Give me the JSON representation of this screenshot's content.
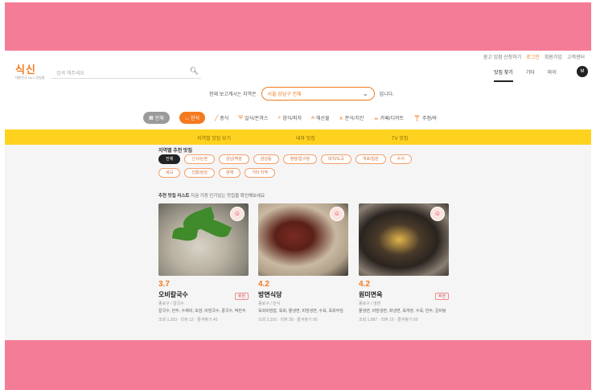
{
  "header": {
    "util_links": [
      "광고 입점 신청하기",
      "로그인",
      "회원가입",
      "고객센터"
    ],
    "logo_text": "식신",
    "logo_sub": "대한민국 No.1 맛집앱",
    "search_placeholder": "검색 해주세요",
    "nav": [
      "맛집 찾기",
      "기타",
      "마이"
    ],
    "avatar_label": "M"
  },
  "location": {
    "label": "현재 보고계시는 지역은",
    "selected": "서울 강남구 전체",
    "suffix": "입니다."
  },
  "categories": [
    {
      "label": "전체",
      "style": "gray",
      "icon": "grid-icon"
    },
    {
      "label": "한식",
      "style": "orange",
      "icon": "bowl-icon"
    },
    {
      "label": "중식",
      "style": "plain",
      "icon": "chopstick-icon"
    },
    {
      "label": "일식/돈까스",
      "style": "plain",
      "icon": "fork-icon"
    },
    {
      "label": "양식/피자",
      "style": "plain",
      "icon": "search-icon"
    },
    {
      "label": "해산물",
      "style": "plain",
      "icon": "fish-icon"
    },
    {
      "label": "분식/치킨",
      "style": "plain",
      "icon": "mountain-icon"
    },
    {
      "label": "카페/디저트",
      "style": "plain",
      "icon": "cup-icon"
    },
    {
      "label": "주점/바",
      "style": "plain",
      "icon": "glass-icon"
    }
  ],
  "tabs": [
    "지역별 맛집 보기",
    "테마 맛집",
    "TV 맛집"
  ],
  "region": {
    "title": "지역별 추천 맛집",
    "chips": [
      "전체",
      "신사/논현",
      "강남/역삼",
      "삼성동",
      "청담/압구정",
      "대치/도곡",
      "개포/일원",
      "수서",
      "세곡",
      "선릉/삼성",
      "양재",
      "기타 지역"
    ],
    "selected_index": 0
  },
  "recommend": {
    "title": "추천 맛집 리스트",
    "subtitle": "지금 가장 인기있는 맛집을 확인해보세요"
  },
  "restaurants": [
    {
      "rating": "3.7",
      "name": "오비칼국수",
      "tag": "추천",
      "location": "종로구 / 칼국수",
      "menu": "칼국수, 만두, 수제비, 보쌈, 비빔국수, 콩국수, 떡만두",
      "stats": "조회 1,203 · 리뷰 12 · 즐겨찾기 45"
    },
    {
      "rating": "4.2",
      "name": "방면식당",
      "tag": "",
      "location": "종로구 / 한식",
      "menu": "육회비빔밥, 육회, 물냉면, 비빔냉면, 수육, 육회무침",
      "stats": "조회 2,310 · 리뷰 28 · 즐겨찾기 90"
    },
    {
      "rating": "4.2",
      "name": "원미면옥",
      "tag": "추천",
      "location": "종로구 / 냉면",
      "menu": "물냉면, 비빔냉면, 회냉면, 육개장, 수육, 만두, 갈비탕",
      "stats": "조회 1,987 · 리뷰 19 · 즐겨찾기 60"
    }
  ],
  "colors": {
    "band": "#f47c97",
    "accent": "#f47a1f",
    "yellow": "#ffd21f"
  }
}
